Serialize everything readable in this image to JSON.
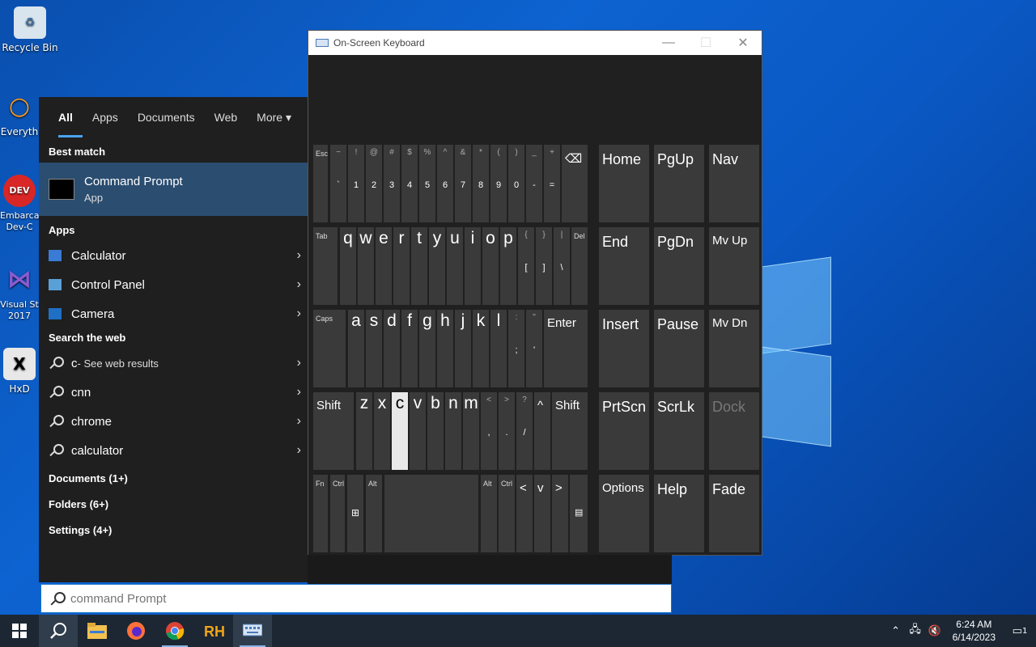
{
  "desktop": {
    "icons": [
      {
        "label": "Recycle Bin"
      },
      {
        "label": "Everyth"
      },
      {
        "label": "Embarca\nDev-C"
      },
      {
        "label": "Visual St\n2017"
      },
      {
        "label": "HxD"
      }
    ]
  },
  "osk": {
    "title": "On-Screen Keyboard",
    "minimize": "—",
    "maximize": "☐",
    "close": "✕",
    "keys": {
      "esc": "Esc",
      "num_top": [
        "~",
        "!",
        "@",
        "#",
        "$",
        "%",
        "^",
        "&",
        "*",
        "(",
        ")",
        "_",
        "+"
      ],
      "num_bot": [
        "`",
        "1",
        "2",
        "3",
        "4",
        "5",
        "6",
        "7",
        "8",
        "9",
        "0",
        "-",
        "="
      ],
      "backspace": "⌫",
      "tab": "Tab",
      "row_q": [
        "q",
        "w",
        "e",
        "r",
        "t",
        "y",
        "u",
        "i",
        "o",
        "p"
      ],
      "brk_top": [
        "{",
        "}",
        "|"
      ],
      "brk_bot": [
        "[",
        "]",
        "\\"
      ],
      "del": "Del",
      "caps": "Caps",
      "row_a": [
        "a",
        "s",
        "d",
        "f",
        "g",
        "h",
        "j",
        "k",
        "l"
      ],
      "semi_top": [
        ":",
        "\""
      ],
      "semi_bot": [
        ";",
        "'"
      ],
      "enter": "Enter",
      "shift": "Shift",
      "row_z": [
        "z",
        "x",
        "c",
        "v",
        "b",
        "n",
        "m"
      ],
      "comma_top": [
        "<",
        ">",
        "?"
      ],
      "comma_bot": [
        ",",
        ".",
        "/"
      ],
      "up": "^",
      "shift_r": "Shift",
      "fn": "Fn",
      "ctrl": "Ctrl",
      "alt": "Alt",
      "alt_r": "Alt",
      "ctrl_r": "Ctrl",
      "left": "<",
      "down": "v",
      "right": ">",
      "home": "Home",
      "pgup": "PgUp",
      "nav": "Nav",
      "end": "End",
      "pgdn": "PgDn",
      "mvup": "Mv Up",
      "insert": "Insert",
      "pause": "Pause",
      "mvdn": "Mv Dn",
      "prtscn": "PrtScn",
      "scrlk": "ScrLk",
      "dock": "Dock",
      "options": "Options",
      "help": "Help",
      "fade": "Fade"
    }
  },
  "start": {
    "tabs": [
      "All",
      "Apps",
      "Documents",
      "Web",
      "More"
    ],
    "best_match_title": "Best match",
    "best_match": {
      "name": "Command Prompt",
      "type": "App"
    },
    "apps_title": "Apps",
    "apps": [
      "Calculator",
      "Control Panel",
      "Camera"
    ],
    "web_title": "Search the web",
    "web_first": "c",
    "web_first_suffix": " - See web results",
    "web_items": [
      "cnn",
      "chrome",
      "calculator"
    ],
    "categories": [
      "Documents (1+)",
      "Folders (6+)",
      "Settings (4+)"
    ]
  },
  "search": {
    "placeholder": "command Prompt"
  },
  "taskbar": {
    "time": "6:24 AM",
    "date": "6/14/2023",
    "notifications": "1"
  }
}
